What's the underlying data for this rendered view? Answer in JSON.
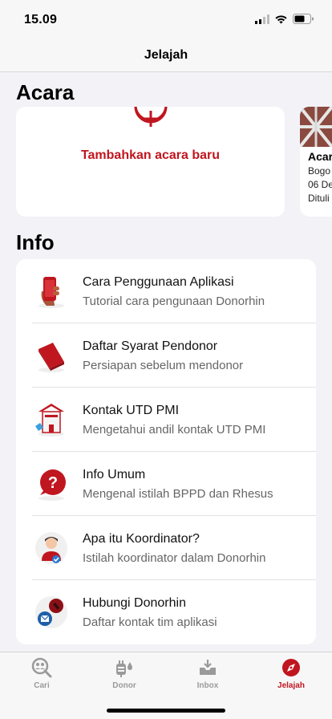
{
  "status": {
    "time": "15.09"
  },
  "nav": {
    "title": "Jelajah"
  },
  "events": {
    "title": "Acara",
    "add_label": "Tambahkan acara baru",
    "card": {
      "title": "Acar",
      "location": "Bogo",
      "date": "06 De",
      "author": "Dituli"
    }
  },
  "info": {
    "title": "Info",
    "items": [
      {
        "title": "Cara Penggunaan Aplikasi",
        "subtitle": "Tutorial cara pengunaan Donorhin",
        "icon": "phone-hand-icon"
      },
      {
        "title": "Daftar Syarat Pendonor",
        "subtitle": "Persiapan sebelum mendonor",
        "icon": "book-icon"
      },
      {
        "title": "Kontak UTD PMI",
        "subtitle": "Mengetahui andil kontak UTD PMI",
        "icon": "building-icon"
      },
      {
        "title": "Info Umum",
        "subtitle": "Mengenal istilah BPPD dan Rhesus",
        "icon": "question-icon"
      },
      {
        "title": "Apa itu Koordinator?",
        "subtitle": "Istilah koordinator dalam Donorhin",
        "icon": "coordinator-icon"
      },
      {
        "title": "Hubungi Donorhin",
        "subtitle": "Daftar kontak tim aplikasi",
        "icon": "contact-icon"
      }
    ]
  },
  "tabs": [
    {
      "label": "Cari",
      "icon": "search-people-icon",
      "active": false
    },
    {
      "label": "Donor",
      "icon": "blood-bag-icon",
      "active": false
    },
    {
      "label": "Inbox",
      "icon": "inbox-icon",
      "active": false
    },
    {
      "label": "Jelajah",
      "icon": "compass-icon",
      "active": true
    }
  ],
  "colors": {
    "accent": "#c0161f",
    "inactive": "#9a9a9a",
    "background": "#f2f2f7"
  }
}
